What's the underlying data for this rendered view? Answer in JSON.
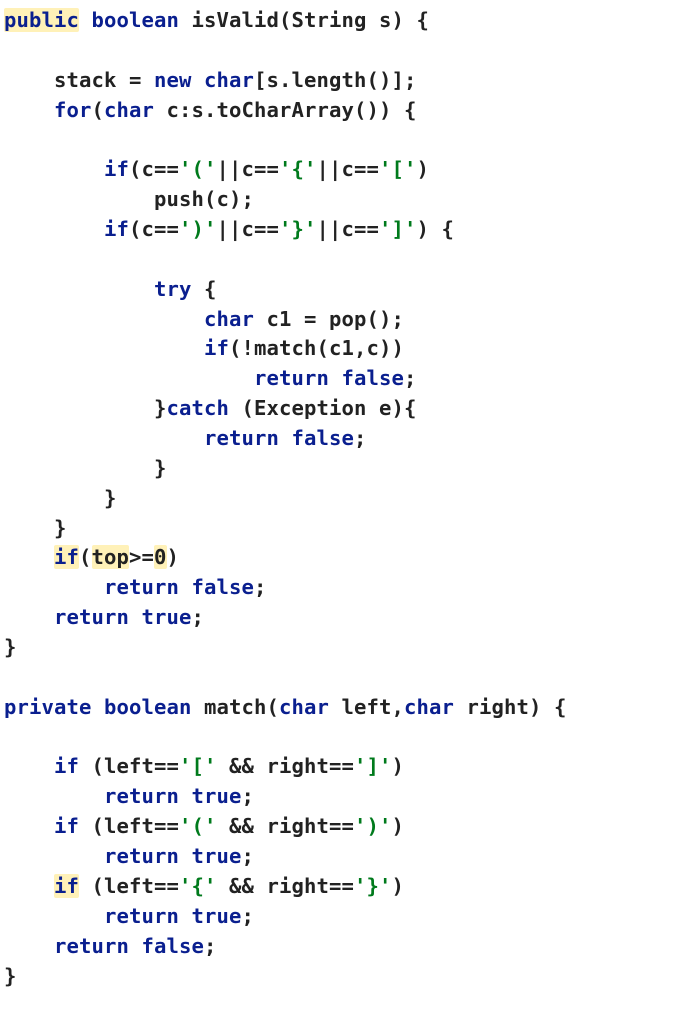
{
  "code": {
    "tokens": [
      [
        [
          "kw hl",
          "public"
        ],
        [
          "",
          ""
        ],
        [
          "",
          " "
        ],
        [
          "kw",
          "boolean"
        ],
        [
          "",
          " isValid(String s) {"
        ]
      ],
      [
        [
          "",
          ""
        ]
      ],
      [
        [
          "",
          "    stack = "
        ],
        [
          "kw",
          "new"
        ],
        [
          "",
          " "
        ],
        [
          "kw",
          "char"
        ],
        [
          "",
          "[s.length()];"
        ]
      ],
      [
        [
          "",
          "    "
        ],
        [
          "kw",
          "for"
        ],
        [
          "",
          "("
        ],
        [
          "kw",
          "char"
        ],
        [
          "",
          " c:s.toCharArray()) {"
        ]
      ],
      [
        [
          "",
          ""
        ]
      ],
      [
        [
          "",
          "        "
        ],
        [
          "kw",
          "if"
        ],
        [
          "",
          "(c=="
        ],
        [
          "str",
          "'('"
        ],
        [
          "",
          "||c=="
        ],
        [
          "str",
          "'{'"
        ],
        [
          "",
          "||c=="
        ],
        [
          "str",
          "'['"
        ],
        [
          "",
          ")"
        ]
      ],
      [
        [
          "",
          "            push(c);"
        ]
      ],
      [
        [
          "",
          "        "
        ],
        [
          "kw",
          "if"
        ],
        [
          "",
          "(c=="
        ],
        [
          "str",
          "')'"
        ],
        [
          "",
          "||c=="
        ],
        [
          "str",
          "'}'"
        ],
        [
          "",
          "||c=="
        ],
        [
          "str",
          "']'"
        ],
        [
          "",
          ") {"
        ]
      ],
      [
        [
          "",
          ""
        ]
      ],
      [
        [
          "",
          "            "
        ],
        [
          "kw",
          "try"
        ],
        [
          "",
          " {"
        ]
      ],
      [
        [
          "",
          "                "
        ],
        [
          "kw",
          "char"
        ],
        [
          "",
          " c1 = pop();"
        ]
      ],
      [
        [
          "",
          "                "
        ],
        [
          "kw",
          "if"
        ],
        [
          "",
          "(!match(c1,c))"
        ]
      ],
      [
        [
          "",
          "                    "
        ],
        [
          "kw",
          "return"
        ],
        [
          "",
          " "
        ],
        [
          "kw",
          "false"
        ],
        [
          "",
          ";"
        ]
      ],
      [
        [
          "",
          "            }"
        ],
        [
          "kw",
          "catch"
        ],
        [
          "",
          " (Exception e){"
        ]
      ],
      [
        [
          "",
          "                "
        ],
        [
          "kw",
          "return"
        ],
        [
          "",
          " "
        ],
        [
          "kw",
          "false"
        ],
        [
          "",
          ";"
        ]
      ],
      [
        [
          "",
          "            }"
        ]
      ],
      [
        [
          "",
          "        }"
        ]
      ],
      [
        [
          "",
          "    }"
        ]
      ],
      [
        [
          "",
          "    "
        ],
        [
          "kw hl",
          "if"
        ],
        [
          "",
          "("
        ],
        [
          "hl",
          "top"
        ],
        [
          "",
          ">="
        ],
        [
          "hl",
          "0"
        ],
        [
          "",
          ")"
        ]
      ],
      [
        [
          "",
          "        "
        ],
        [
          "kw",
          "return"
        ],
        [
          "",
          " "
        ],
        [
          "kw",
          "false"
        ],
        [
          "",
          ";"
        ]
      ],
      [
        [
          "",
          "    "
        ],
        [
          "kw",
          "return"
        ],
        [
          "",
          " "
        ],
        [
          "kw",
          "true"
        ],
        [
          "",
          ";"
        ]
      ],
      [
        [
          "",
          "}"
        ]
      ],
      [
        [
          "",
          ""
        ]
      ],
      [
        [
          "kw",
          "private"
        ],
        [
          "",
          " "
        ],
        [
          "kw",
          "boolean"
        ],
        [
          "",
          " match("
        ],
        [
          "kw",
          "char"
        ],
        [
          "",
          " left,"
        ],
        [
          "kw",
          "char"
        ],
        [
          "",
          " right) {"
        ]
      ],
      [
        [
          "",
          ""
        ]
      ],
      [
        [
          "",
          "    "
        ],
        [
          "kw",
          "if"
        ],
        [
          "",
          " (left=="
        ],
        [
          "str",
          "'['"
        ],
        [
          "",
          " && right=="
        ],
        [
          "str",
          "']'"
        ],
        [
          "",
          ")"
        ]
      ],
      [
        [
          "",
          "        "
        ],
        [
          "kw",
          "return"
        ],
        [
          "",
          " "
        ],
        [
          "kw",
          "true"
        ],
        [
          "",
          ";"
        ]
      ],
      [
        [
          "",
          "    "
        ],
        [
          "kw",
          "if"
        ],
        [
          "",
          " (left=="
        ],
        [
          "str",
          "'('"
        ],
        [
          "",
          " && right=="
        ],
        [
          "str",
          "')'"
        ],
        [
          "",
          ")"
        ]
      ],
      [
        [
          "",
          "        "
        ],
        [
          "kw",
          "return"
        ],
        [
          "",
          " "
        ],
        [
          "kw",
          "true"
        ],
        [
          "",
          ";"
        ]
      ],
      [
        [
          "",
          "    "
        ],
        [
          "kw hl",
          "if"
        ],
        [
          "",
          " (left=="
        ],
        [
          "str",
          "'{'"
        ],
        [
          "",
          " && right=="
        ],
        [
          "str",
          "'}'"
        ],
        [
          "",
          ")"
        ]
      ],
      [
        [
          "",
          "        "
        ],
        [
          "kw",
          "return"
        ],
        [
          "",
          " "
        ],
        [
          "kw",
          "true"
        ],
        [
          "",
          ";"
        ]
      ],
      [
        [
          "",
          "    "
        ],
        [
          "kw",
          "return"
        ],
        [
          "",
          " "
        ],
        [
          "kw",
          "false"
        ],
        [
          "",
          ";"
        ]
      ],
      [
        [
          "",
          "}"
        ]
      ]
    ]
  }
}
